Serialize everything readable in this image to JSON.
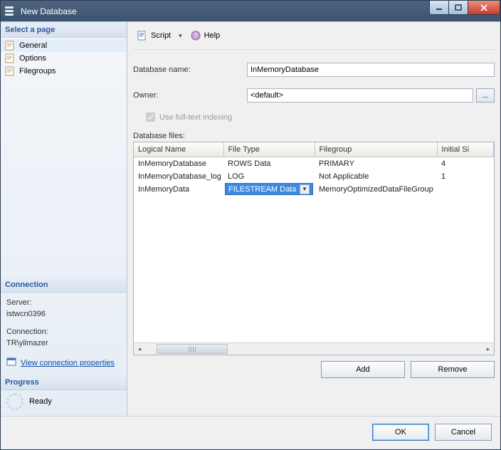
{
  "window": {
    "title": "New Database"
  },
  "sidebar": {
    "select_page": "Select a page",
    "items": [
      {
        "label": "General"
      },
      {
        "label": "Options"
      },
      {
        "label": "Filegroups"
      }
    ],
    "connection_title": "Connection",
    "server_label": "Server:",
    "server_value": "istwcn0396",
    "connection_label": "Connection:",
    "connection_value": "TR\\yilmazer",
    "view_props": "View connection properties",
    "progress_title": "Progress",
    "progress_status": "Ready"
  },
  "toolbar": {
    "script": "Script",
    "help": "Help"
  },
  "form": {
    "dbname_label": "Database name:",
    "dbname_value": "InMemoryDatabase",
    "owner_label": "Owner:",
    "owner_value": "<default>",
    "fulltext_label": "Use full-text indexing",
    "files_label": "Database files:"
  },
  "grid": {
    "headers": {
      "logical": "Logical Name",
      "filetype": "File Type",
      "filegroup": "Filegroup",
      "initial": "Initial Si"
    },
    "rows": [
      {
        "logical": "InMemoryDatabase",
        "filetype": "ROWS Data",
        "filegroup": "PRIMARY",
        "initial": "4"
      },
      {
        "logical": "InMemoryDatabase_log",
        "filetype": "LOG",
        "filegroup": "Not Applicable",
        "initial": "1"
      },
      {
        "logical": "InMemoryData",
        "filetype": "FILESTREAM Data",
        "filegroup": "MemoryOptimizedDataFileGroup",
        "initial": ""
      }
    ]
  },
  "buttons": {
    "add": "Add",
    "remove": "Remove",
    "ok": "OK",
    "cancel": "Cancel"
  }
}
